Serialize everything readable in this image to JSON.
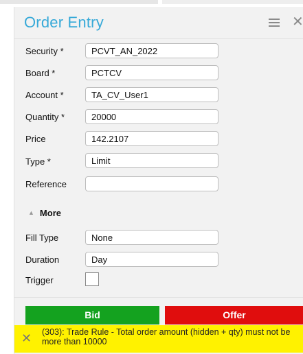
{
  "window": {
    "title": "Order Entry",
    "menu_icon": "hamburger-menu-icon",
    "close_icon": "close-icon"
  },
  "form": {
    "security": {
      "label": "Security *",
      "value": "PCVT_AN_2022"
    },
    "board": {
      "label": "Board *",
      "value": "PCTCV"
    },
    "account": {
      "label": "Account *",
      "value": "TA_CV_User1"
    },
    "quantity": {
      "label": "Quantity *",
      "value": "20000"
    },
    "price": {
      "label": "Price",
      "value": "142.2107"
    },
    "type": {
      "label": "Type *",
      "value": "Limit"
    },
    "reference": {
      "label": "Reference",
      "value": ""
    }
  },
  "more": {
    "label": "More",
    "icon": "caret-up-icon"
  },
  "advanced": {
    "fill_type": {
      "label": "Fill Type",
      "value": "None"
    },
    "duration": {
      "label": "Duration",
      "value": "Day"
    },
    "trigger": {
      "label": "Trigger",
      "checked": false
    }
  },
  "actions": {
    "bid_label": "Bid",
    "offer_label": "Offer",
    "bid_color": "#14a21f",
    "offer_color": "#e00d0d"
  },
  "alert": {
    "message": "(303): Trade Rule - Total order amount (hidden + qty) must not be more than 10000",
    "background": "#fff200"
  },
  "accent_color": "#36a9d8"
}
